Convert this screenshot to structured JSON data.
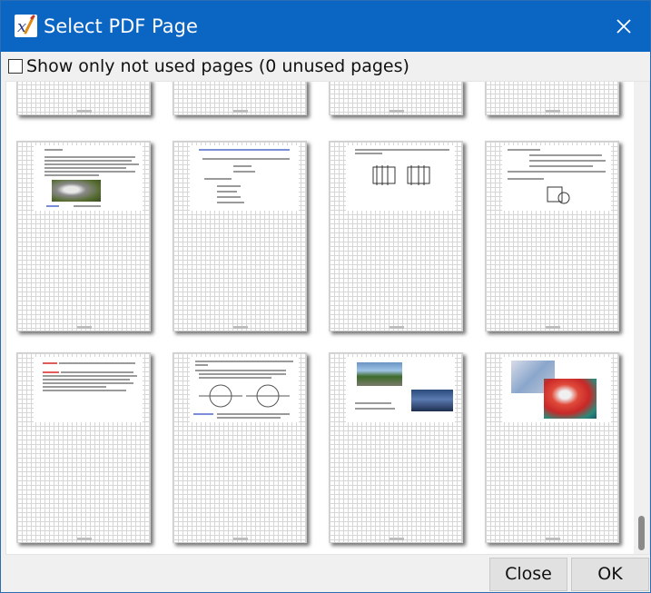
{
  "window": {
    "title": "Select PDF Page",
    "app_icon": "xournal-app-icon",
    "close_icon": "close-icon"
  },
  "filter": {
    "checkbox_label": "Show only not used pages (0 unused pages)",
    "checked": false
  },
  "pages": [
    {
      "id": 1,
      "kind": "clipped"
    },
    {
      "id": 2,
      "kind": "clipped"
    },
    {
      "id": 3,
      "kind": "clipped"
    },
    {
      "id": 4,
      "kind": "clipped"
    },
    {
      "id": 5,
      "kind": "text-with-photo"
    },
    {
      "id": 6,
      "kind": "blue-heading-formulas"
    },
    {
      "id": 7,
      "kind": "diagram-sketch"
    },
    {
      "id": 8,
      "kind": "formulas-with-figure"
    },
    {
      "id": 9,
      "kind": "text-red-highlights"
    },
    {
      "id": 10,
      "kind": "circle-diagrams"
    },
    {
      "id": 11,
      "kind": "photos-with-caption"
    },
    {
      "id": 12,
      "kind": "color-images"
    }
  ],
  "buttons": {
    "close": "Close",
    "ok": "OK"
  },
  "colors": {
    "titlebar": "#0b65c2",
    "accent": "#0b65c2"
  }
}
